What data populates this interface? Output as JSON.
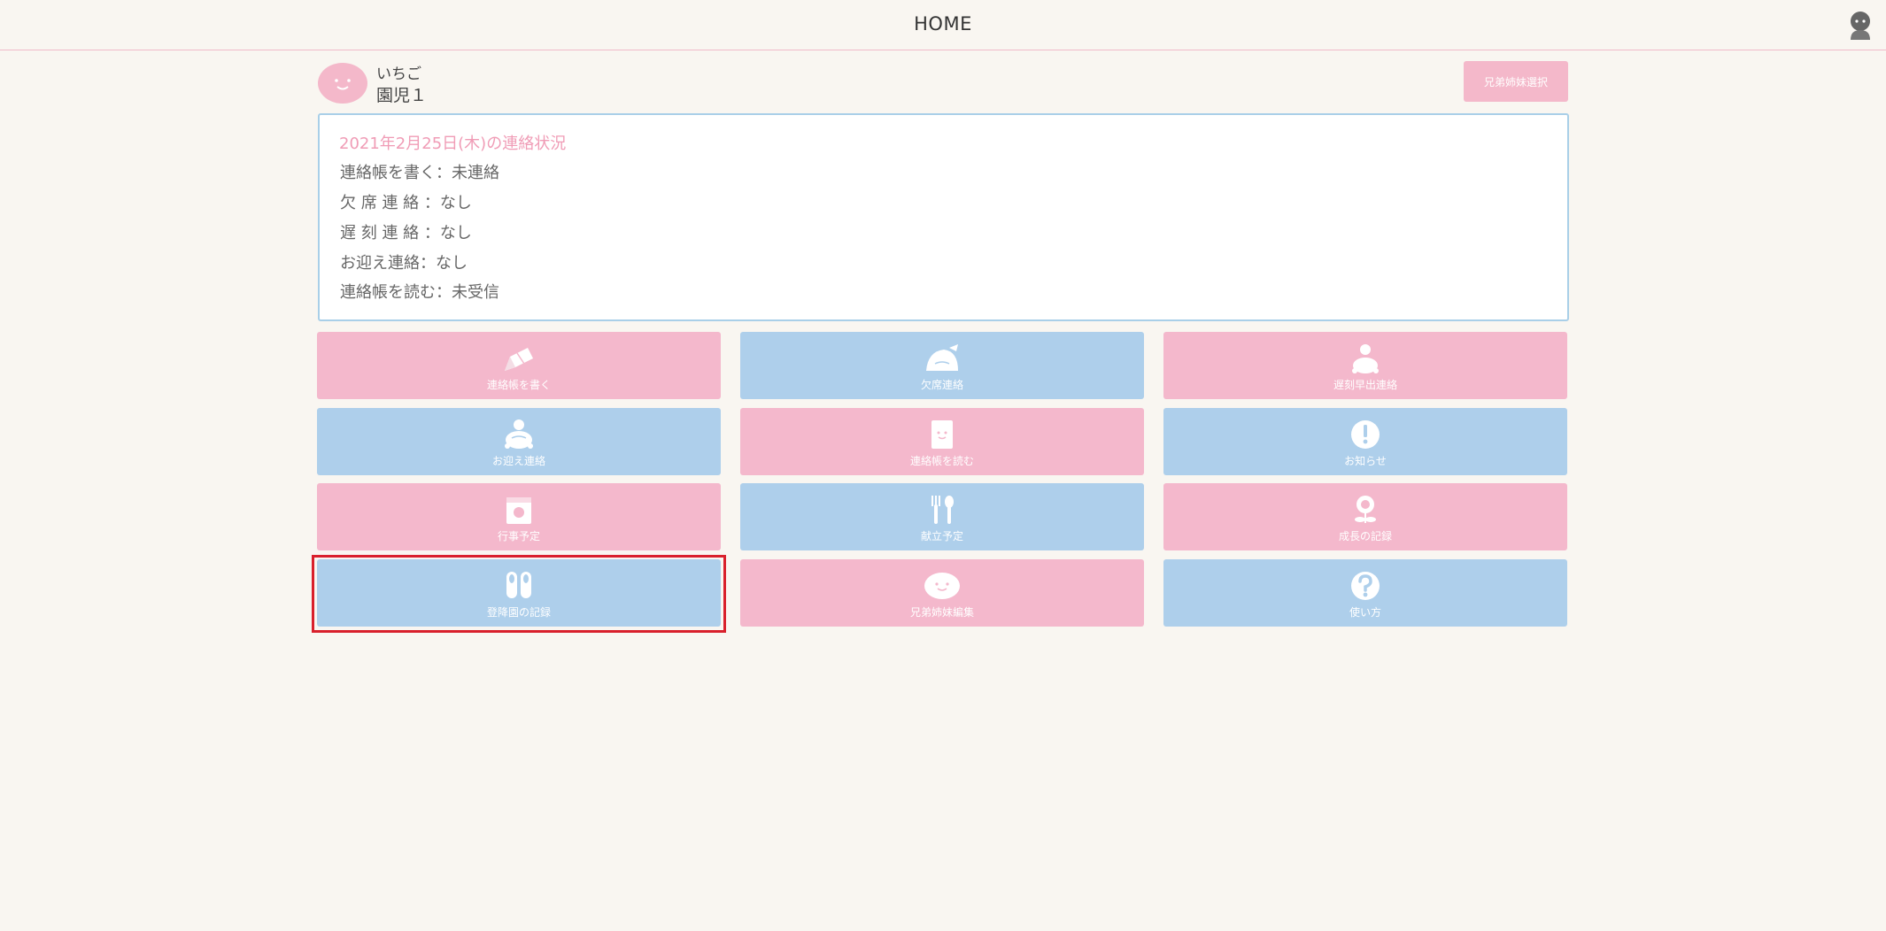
{
  "header": {
    "title": "HOME",
    "user_icon": "person-icon"
  },
  "child": {
    "name": "いちご",
    "class_name": "園児１",
    "avatar_icon": "smile-face-icon"
  },
  "sibling_select_label": "兄弟姉妹選択",
  "status": {
    "title": "2021年2月25日(木)の連絡状況",
    "lines": [
      "連絡帳を書く：未連絡",
      "欠 席 連 絡 ：なし",
      "遅 刻 連 絡 ：なし",
      "お迎え連絡：なし",
      "連絡帳を読む：未受信"
    ]
  },
  "tiles": [
    {
      "label": "連絡帳を書く",
      "icon": "pencil-icon",
      "color": "#f4b8cc"
    },
    {
      "label": "欠席連絡",
      "icon": "sleeping-turtle-icon",
      "color": "#aecfeb"
    },
    {
      "label": "遅刻早出連絡",
      "icon": "turtle-alarm-icon",
      "color": "#f4b8cc"
    },
    {
      "label": "お迎え連絡",
      "icon": "turtle-icon",
      "color": "#aecfeb"
    },
    {
      "label": "連絡帳を読む",
      "icon": "notebook-icon",
      "color": "#f4b8cc"
    },
    {
      "label": "お知らせ",
      "icon": "exclamation-icon",
      "color": "#aecfeb"
    },
    {
      "label": "行事予定",
      "icon": "calendar-icon",
      "color": "#f4b8cc"
    },
    {
      "label": "献立予定",
      "icon": "fork-spoon-icon",
      "color": "#aecfeb"
    },
    {
      "label": "成長の記録",
      "icon": "flower-icon",
      "color": "#f4b8cc"
    },
    {
      "label": "登降園の記録",
      "icon": "shoes-icon",
      "color": "#aecfeb"
    },
    {
      "label": "兄弟姉妹編集",
      "icon": "smile-face-icon",
      "color": "#f4b8cc"
    },
    {
      "label": "使い方",
      "icon": "question-icon",
      "color": "#aecfeb"
    }
  ],
  "colors": {
    "pink": "#f4b8cc",
    "blue": "#aecfeb",
    "status_title": "#f09cb6",
    "highlight": "#d9202c",
    "background": "#f9f6f1"
  }
}
